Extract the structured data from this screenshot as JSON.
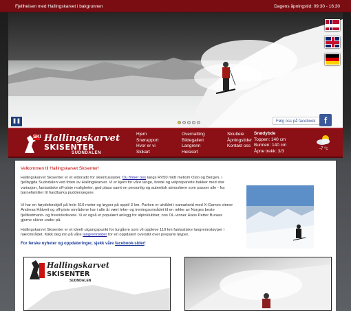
{
  "topbar": {
    "left_text": "Fjellheisen med Hallingskarvet i bakgrunnen",
    "right_text": "Dagens åpningstid: 09:30 - 16:30"
  },
  "hero": {
    "slides": 5,
    "active_slide": 1,
    "pause_label": "❚❚",
    "facebook_text": "Følg oss på facebook",
    "facebook_icon": "f"
  },
  "flags": [
    "norwegian-flag",
    "british-flag",
    "german-flag"
  ],
  "logo": {
    "badge": "SKI",
    "line1": "Hallingskarvet",
    "line2": "SKISENTER",
    "line3": "SUDNDALEN"
  },
  "nav": {
    "col1": [
      "Hjem",
      "Snørapport",
      "Hvor er vi",
      "Skikart"
    ],
    "col2": [
      "Overnatting",
      "Bildegalleri",
      "Langrenn",
      "Heiskort"
    ],
    "col3": [
      "Skiutleie",
      "Åpningstider",
      "Kontakt oss"
    ]
  },
  "snow": {
    "heading": "Snødybde",
    "top": "Toppen: 140 cm",
    "bottom": "Bunnen: 140 cm",
    "lifts": "Åpne trekk: 3/3"
  },
  "weather": {
    "temp": "-7 °c",
    "icon": "partly-cloudy-icon"
  },
  "content": {
    "welcome": "Velkommen til Hallingskarvet Skisenter!",
    "p1_a": "Hallingskarvet Skisenter er et eldorado for skientusiaster. ",
    "p1_link": "Du finner oss",
    "p1_b": " langs RV50 midt mellom Oslo og Bergen, i fjellbygda Sudndalen ved foten av Hallingskarvet. Vi er kjent for våre lange, brede og velpreparerte bakker med stor variasjon, fantastiske off-piste muligheter, god plass samt en personlig og autentisk atmosfære som passer alle - fra barnefamilier til hardbarka puddersjegere.",
    "p2": "Vi har en høydeforskjell på hele 510 meter og løyper på opptil 3 km. Parken er utviklet i samarbeid med X-Games vinner Andreas Håtveit og off-piste områdene har i alle år vært lekе- og treningsområdet til en rekke av Norges beste fjellfestmann- og freeridedsvere. Vi er også et populært anlegg for alpinklubber, nos OL-vinner Hans Petter Buraas gjerne skiver under på.",
    "p3_a": "Hallingskarvet Skisenter er et ideelt utgangspunkt for turgåere som vil oppleve 110 km fantastiske langrennsløyper i nærområdet. Klikk deg inn på våre ",
    "p3_link": "langrennsider",
    "p3_b": " for en oppdatert oversikt over preparte løyper.",
    "news_a": "For ferske nyheter og oppdateringer, sjekk våre ",
    "news_link": "facebook-sider",
    "news_b": "!"
  }
}
